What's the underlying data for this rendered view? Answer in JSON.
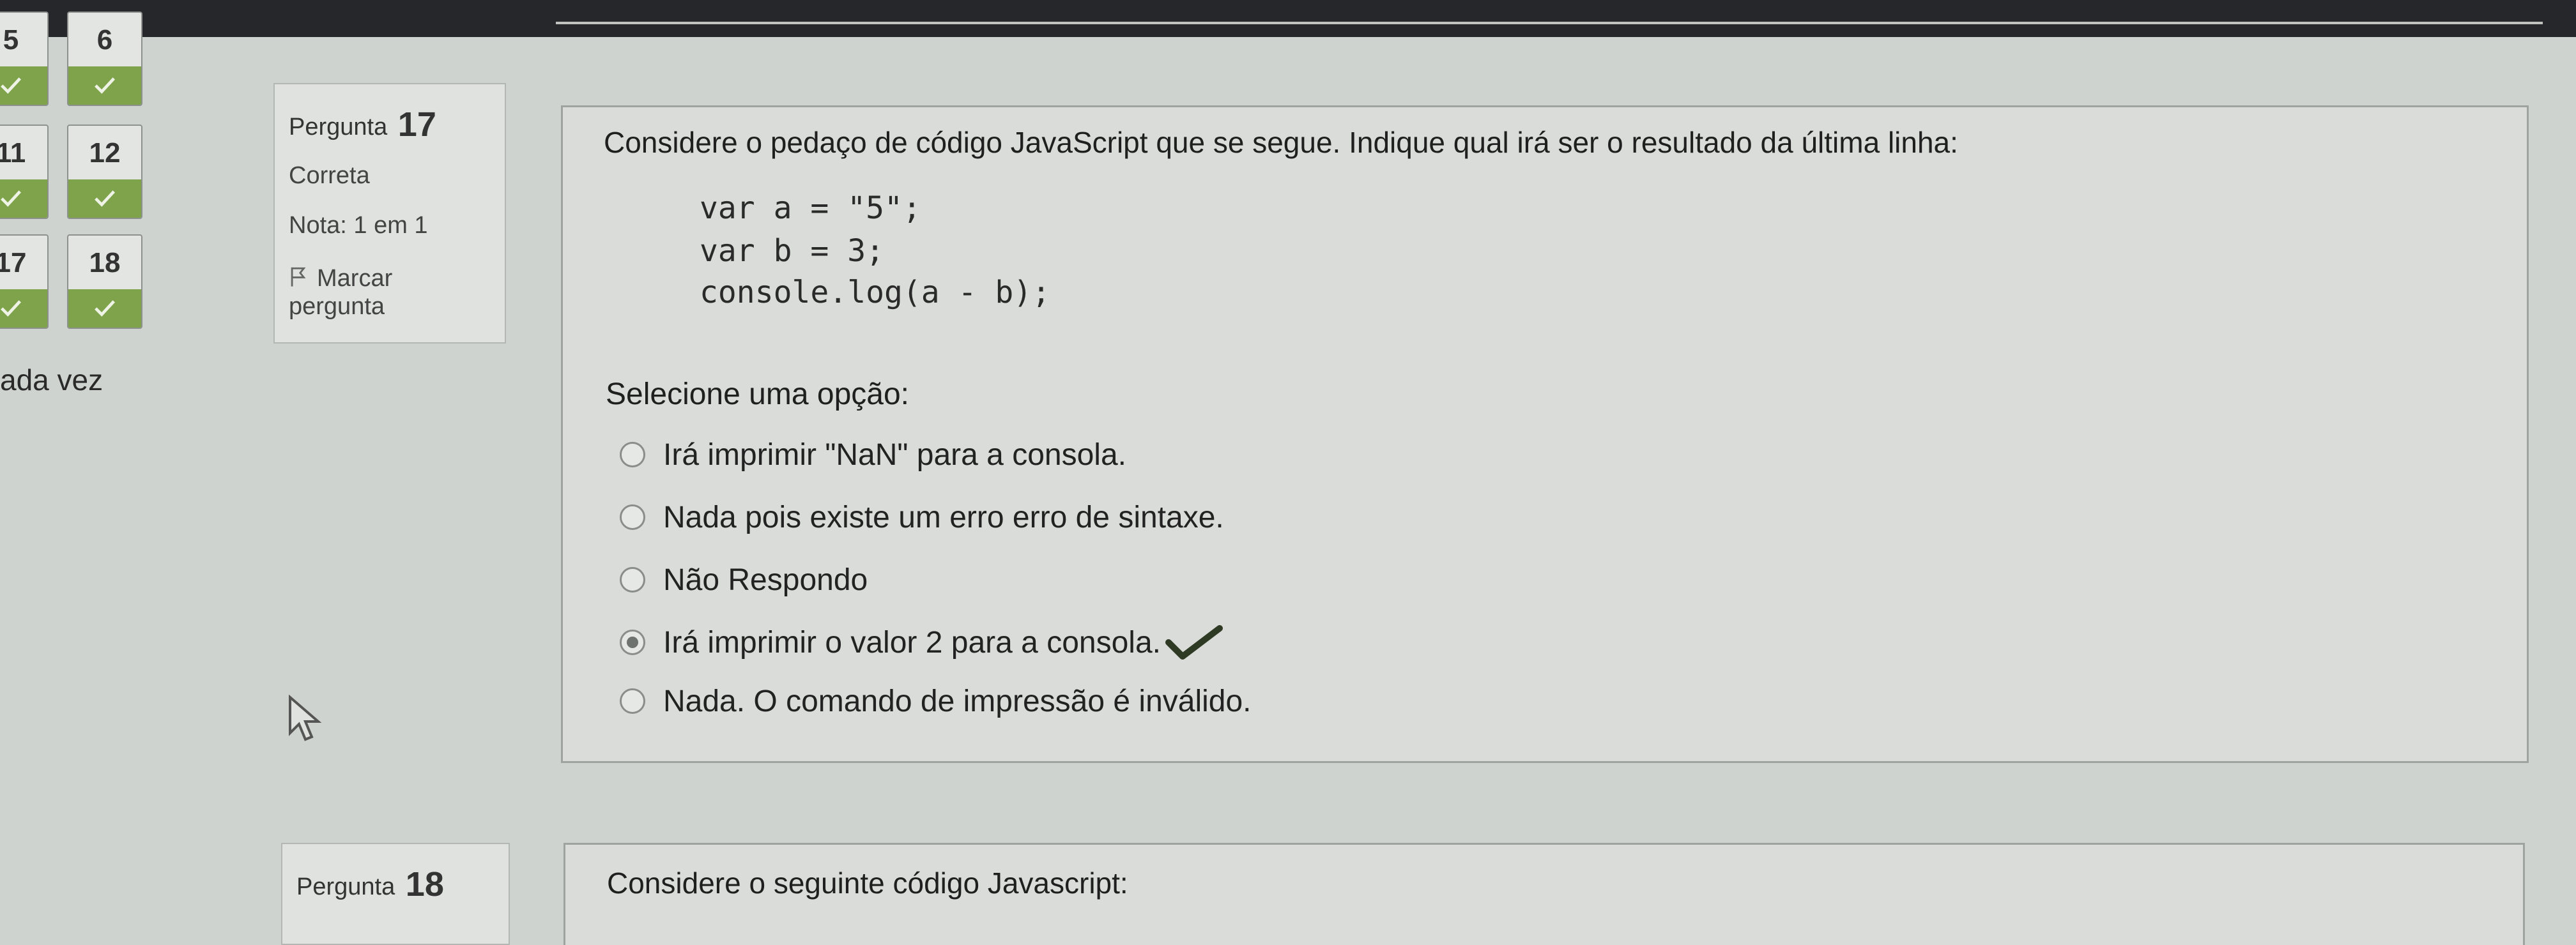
{
  "nav": {
    "buttons": [
      {
        "number": "5",
        "status": "answered-correct"
      },
      {
        "number": "6",
        "status": "answered-correct"
      },
      {
        "number": "11",
        "status": "answered-correct"
      },
      {
        "number": "12",
        "status": "answered-correct"
      },
      {
        "number": "17",
        "status": "answered-correct"
      },
      {
        "number": "18",
        "status": "answered-correct"
      }
    ],
    "status_icon": "check-icon",
    "status_color": "#7ea34a",
    "side_text": "ada vez"
  },
  "question17": {
    "label": "Pergunta",
    "number": "17",
    "state": "Correta",
    "grade": "Nota: 1 em 1",
    "flag_icon": "flag-icon",
    "flag_line1": "Marcar",
    "flag_line2": "pergunta",
    "text": "Considere o pedaço de código JavaScript que se segue. Indique qual irá ser o resultado da última linha:",
    "code": [
      "var a = \"5\";",
      "var b = 3;",
      "console.log(a - b);"
    ],
    "select_label": "Selecione uma opção:",
    "options": [
      {
        "label": "Irá imprimir \"NaN\" para a consola.",
        "checked": false
      },
      {
        "label": "Nada pois existe um erro erro de sintaxe.",
        "checked": false
      },
      {
        "label": "Não Respondo",
        "checked": false
      },
      {
        "label": "Irá imprimir o valor 2 para a consola.",
        "checked": true
      },
      {
        "label": "Nada. O comando de impressão é inválido.",
        "checked": false
      }
    ],
    "correct_icon": "checkmark-icon"
  },
  "question18": {
    "label": "Pergunta",
    "number": "18",
    "text": "Considere o seguinte código Javascript:"
  }
}
